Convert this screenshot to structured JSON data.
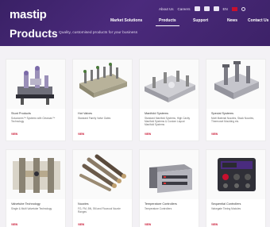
{
  "header": {
    "logo": "mastip",
    "utility": [
      "About Us",
      "Careers",
      "EN"
    ],
    "nav": [
      "Market Solutions",
      "Products",
      "Support",
      "News",
      "Contact Us"
    ],
    "title": "Products",
    "tagline": "Quality, customised products for your business"
  },
  "products": [
    {
      "name": "Stunt Products",
      "desc": "Soluciones™ Systems with Clearcan™ Technology",
      "view": "VIEW"
    },
    {
      "name": "Hot Valves",
      "desc": "Standard Family Valve Gates",
      "view": "VIEW"
    },
    {
      "name": "Manifold Systems",
      "desc": "Standard Manifold Systems, High Cavity Manifold Systems & Custom Layout Manifold Systems",
      "view": "VIEW"
    },
    {
      "name": "Special Systems",
      "desc": "Multi Material Nozzles, Stack Nozzles, Thermoset Moulding etc.",
      "view": "VIEW"
    },
    {
      "name": "Valvetube Technology",
      "desc": "Single & Multi Valvetube Technology",
      "view": "VIEW"
    },
    {
      "name": "Nozzles",
      "desc": "FG, FM, BN, SM and Flowcool Nozzle Ranges",
      "view": "VIEW"
    },
    {
      "name": "Temperature Controllers",
      "desc": "Temperature Controllers",
      "view": "VIEW"
    },
    {
      "name": "Sequential Controllers",
      "desc": "Valvegate Timing Modules",
      "view": "VIEW"
    }
  ]
}
